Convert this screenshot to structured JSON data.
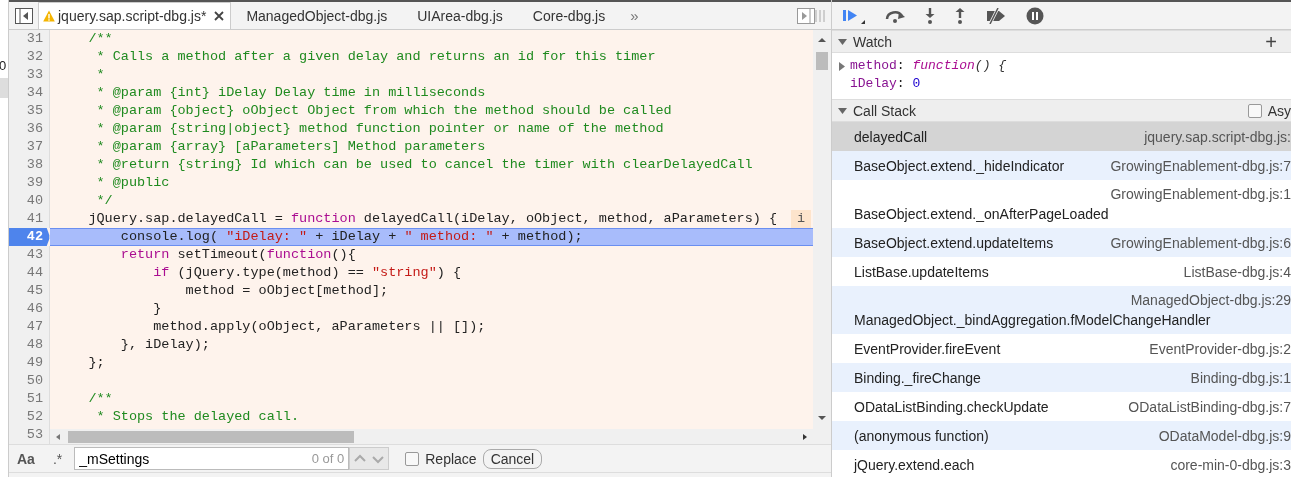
{
  "left_strip": {
    "text": "0"
  },
  "tabs": [
    {
      "label": "jquery.sap.script-dbg.js*",
      "selected": true,
      "warning": true,
      "closable": true
    },
    {
      "label": "ManagedObject-dbg.js",
      "selected": false,
      "warning": false,
      "closable": false
    },
    {
      "label": "UIArea-dbg.js",
      "selected": false,
      "warning": false,
      "closable": false
    },
    {
      "label": "Core-dbg.js",
      "selected": false,
      "warning": false,
      "closable": false
    }
  ],
  "tabs_overflow": "»",
  "code": {
    "lines": [
      {
        "number": "31",
        "current": false,
        "tokens": [
          {
            "kind": "comment",
            "text": "    /**"
          }
        ]
      },
      {
        "number": "32",
        "current": false,
        "tokens": [
          {
            "kind": "comment",
            "text": "     * Calls a method after a given delay and returns an id for this timer"
          }
        ]
      },
      {
        "number": "33",
        "current": false,
        "tokens": [
          {
            "kind": "comment",
            "text": "     *"
          }
        ]
      },
      {
        "number": "34",
        "current": false,
        "tokens": [
          {
            "kind": "comment",
            "text": "     * @param {int} iDelay Delay time in milliseconds"
          }
        ]
      },
      {
        "number": "35",
        "current": false,
        "tokens": [
          {
            "kind": "comment",
            "text": "     * @param {object} oObject Object from which the method should be called"
          }
        ]
      },
      {
        "number": "36",
        "current": false,
        "tokens": [
          {
            "kind": "comment",
            "text": "     * @param {string|object} method function pointer or name of the method"
          }
        ]
      },
      {
        "number": "37",
        "current": false,
        "tokens": [
          {
            "kind": "comment",
            "text": "     * @param {array} [aParameters] Method parameters"
          }
        ]
      },
      {
        "number": "38",
        "current": false,
        "tokens": [
          {
            "kind": "comment",
            "text": "     * @return {string} Id which can be used to cancel the timer with clearDelayedCall"
          }
        ]
      },
      {
        "number": "39",
        "current": false,
        "tokens": [
          {
            "kind": "comment",
            "text": "     * @public"
          }
        ]
      },
      {
        "number": "40",
        "current": false,
        "tokens": [
          {
            "kind": "comment",
            "text": "     */"
          }
        ]
      },
      {
        "number": "41",
        "current": false,
        "inline_hint": "i",
        "tokens": [
          {
            "kind": "plain",
            "text": "    jQuery.sap.delayedCall = "
          },
          {
            "kind": "keyword",
            "text": "function"
          },
          {
            "kind": "plain",
            "text": " delayedCall(iDelay, oObject, method, aParameters) {"
          }
        ]
      },
      {
        "number": "42",
        "current": true,
        "tokens": [
          {
            "kind": "plain",
            "text": "        console.log( "
          },
          {
            "kind": "string",
            "text": "\"iDelay: \""
          },
          {
            "kind": "plain",
            "text": " + iDelay + "
          },
          {
            "kind": "string",
            "text": "\" method: \""
          },
          {
            "kind": "plain",
            "text": " + method);"
          }
        ]
      },
      {
        "number": "43",
        "current": false,
        "tokens": [
          {
            "kind": "keyword",
            "text": "        return"
          },
          {
            "kind": "plain",
            "text": " setTimeout("
          },
          {
            "kind": "keyword",
            "text": "function"
          },
          {
            "kind": "plain",
            "text": "(){"
          }
        ]
      },
      {
        "number": "44",
        "current": false,
        "tokens": [
          {
            "kind": "keyword",
            "text": "            if"
          },
          {
            "kind": "plain",
            "text": " (jQuery.type(method) == "
          },
          {
            "kind": "string",
            "text": "\"string\""
          },
          {
            "kind": "plain",
            "text": ") {"
          }
        ]
      },
      {
        "number": "45",
        "current": false,
        "tokens": [
          {
            "kind": "plain",
            "text": "                method = oObject[method];"
          }
        ]
      },
      {
        "number": "46",
        "current": false,
        "tokens": [
          {
            "kind": "plain",
            "text": "            }"
          }
        ]
      },
      {
        "number": "47",
        "current": false,
        "tokens": [
          {
            "kind": "plain",
            "text": "            method.apply(oObject, aParameters || []);"
          }
        ]
      },
      {
        "number": "48",
        "current": false,
        "tokens": [
          {
            "kind": "plain",
            "text": "        }, iDelay);"
          }
        ]
      },
      {
        "number": "49",
        "current": false,
        "tokens": [
          {
            "kind": "plain",
            "text": "    };"
          }
        ]
      },
      {
        "number": "50",
        "current": false
      },
      {
        "number": "51",
        "current": false,
        "tokens": [
          {
            "kind": "comment",
            "text": "    /**"
          }
        ]
      },
      {
        "number": "52",
        "current": false,
        "tokens": [
          {
            "kind": "comment",
            "text": "     * Stops the delayed call."
          }
        ]
      },
      {
        "number": "53",
        "current": false
      }
    ]
  },
  "find_bar": {
    "case_toggle": "Aa",
    "regex_toggle": ".*",
    "value": "_mSettings",
    "match_count": "0 of 0",
    "replace": {
      "label": "Replace",
      "checked": false
    },
    "cancel": "Cancel"
  },
  "watch": {
    "title": "Watch",
    "expanded": true,
    "add": "+",
    "items": [
      {
        "name": "method",
        "separator": ":",
        "kind": "function",
        "value": "function",
        "value_suffix": "() {",
        "expandable": true
      },
      {
        "name": "iDelay",
        "separator": ":",
        "kind": "number",
        "value": "0",
        "expandable": false
      }
    ]
  },
  "call_stack": {
    "title": "Call Stack",
    "expanded": true,
    "async": {
      "label": "Asy",
      "checked": false
    },
    "frames": [
      {
        "name": "delayedCall",
        "location": "jquery.sap.script-dbg.js:",
        "selected": true
      },
      {
        "name": "BaseObject.extend._hideIndicator",
        "location": "GrowingEnablement-dbg.js:7",
        "selected": false
      },
      {
        "name": "BaseObject.extend._onAfterPageLoaded",
        "location": "GrowingEnablement-dbg.js:1",
        "selected": false
      },
      {
        "name": "BaseObject.extend.updateItems",
        "location": "GrowingEnablement-dbg.js:6",
        "selected": false
      },
      {
        "name": "ListBase.updateItems",
        "location": "ListBase-dbg.js:4",
        "selected": false
      },
      {
        "name": "ManagedObject._bindAggregation.fModelChangeHandler",
        "location": "ManagedObject-dbg.js:29",
        "selected": false
      },
      {
        "name": "EventProvider.fireEvent",
        "location": "EventProvider-dbg.js:2",
        "selected": false
      },
      {
        "name": "Binding._fireChange",
        "location": "Binding-dbg.js:1",
        "selected": false
      },
      {
        "name": "ODataListBinding.checkUpdate",
        "location": "ODataListBinding-dbg.js:7",
        "selected": false
      },
      {
        "name": "(anonymous function)",
        "location": "ODataModel-dbg.js:9",
        "selected": false
      },
      {
        "name": "jQuery.extend.each",
        "location": "core-min-0-dbg.js:3",
        "selected": false
      }
    ]
  }
}
